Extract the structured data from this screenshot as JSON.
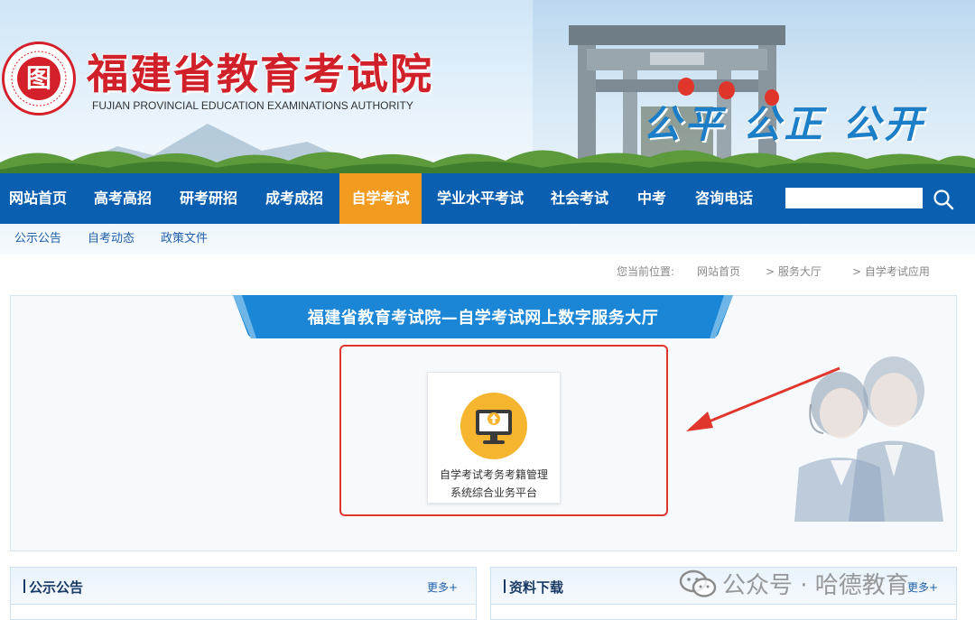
{
  "header": {
    "seal_glyph": "图",
    "title": "福建省教育考试院",
    "subtitle": "FUJIAN PROVINCIAL EDUCATION EXAMINATIONS AUTHORITY",
    "slogan": "公平 公正 公开",
    "brand_red": "#d0202a",
    "slogan_blue": "#1b7ec6"
  },
  "nav": {
    "items": [
      {
        "label": "网站首页",
        "active": false
      },
      {
        "label": "高考高招",
        "active": false
      },
      {
        "label": "研考研招",
        "active": false
      },
      {
        "label": "成考成招",
        "active": false
      },
      {
        "label": "自学考试",
        "active": true
      },
      {
        "label": "学业水平考试",
        "active": false
      },
      {
        "label": "社会考试",
        "active": false
      },
      {
        "label": "中考",
        "active": false
      },
      {
        "label": "咨询电话",
        "active": false
      }
    ],
    "search_placeholder": "",
    "search_icon": "search-icon",
    "bg_color": "#0a5fb0",
    "active_color": "#f29b21"
  },
  "subnav": {
    "items": [
      "公示公告",
      "自考动态",
      "政策文件"
    ]
  },
  "breadcrumb": {
    "prefix": "您当前位置:",
    "items": [
      "网站首页",
      "> 服务大厅",
      "> 自学考试应用"
    ]
  },
  "main": {
    "ribbon_title": "福建省教育考试院—自学考试网上数字服务大厅",
    "card": {
      "icon": "computer-upload-icon",
      "label_line1": "自学考试考务考籍管理",
      "label_line2": "系统综合业务平台"
    },
    "highlight_color": "#e0362c"
  },
  "boxes": [
    {
      "title": "公示公告",
      "more": "更多+"
    },
    {
      "title": "资料下载",
      "more": "更多+"
    }
  ],
  "watermark": {
    "icon": "wechat-icon",
    "text": "公众号 · 哈德教育"
  }
}
